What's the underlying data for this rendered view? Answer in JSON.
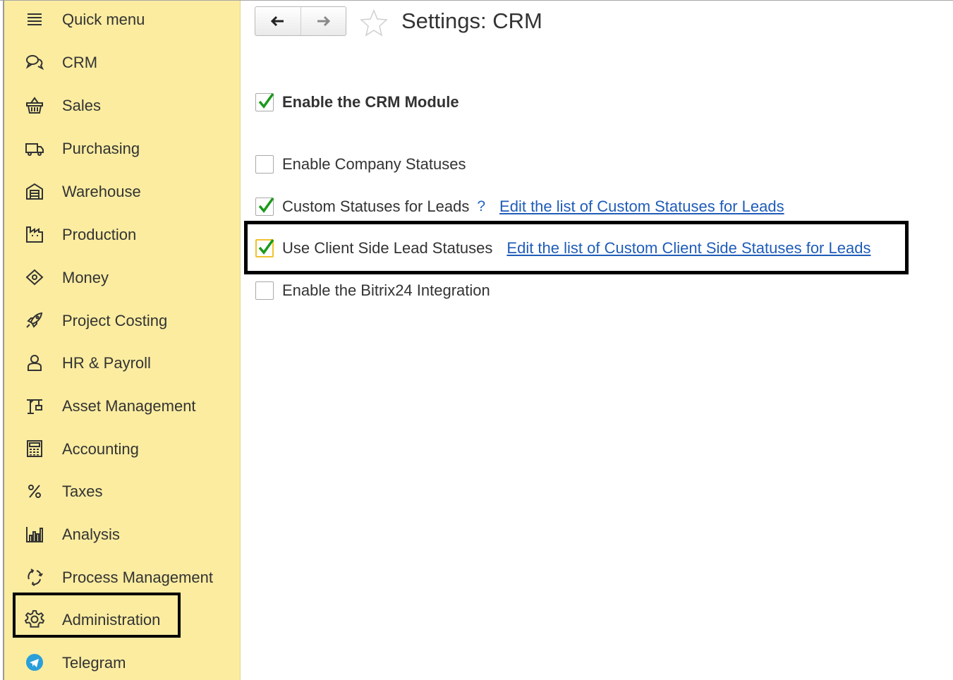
{
  "sidebar": {
    "items": [
      {
        "label": "Quick menu",
        "icon": "hamburger-menu-icon"
      },
      {
        "label": "CRM",
        "icon": "chat-bubbles-icon"
      },
      {
        "label": "Sales",
        "icon": "shopping-basket-icon"
      },
      {
        "label": "Purchasing",
        "icon": "truck-icon"
      },
      {
        "label": "Warehouse",
        "icon": "warehouse-icon"
      },
      {
        "label": "Production",
        "icon": "factory-icon"
      },
      {
        "label": "Money",
        "icon": "money-tag-icon"
      },
      {
        "label": "Project Costing",
        "icon": "rocket-icon"
      },
      {
        "label": "HR & Payroll",
        "icon": "person-icon"
      },
      {
        "label": "Asset Management",
        "icon": "crane-icon"
      },
      {
        "label": "Accounting",
        "icon": "calculator-icon"
      },
      {
        "label": "Taxes",
        "icon": "percent-icon"
      },
      {
        "label": "Analysis",
        "icon": "bar-chart-icon"
      },
      {
        "label": "Process Management",
        "icon": "cycle-arrows-icon"
      },
      {
        "label": "Administration",
        "icon": "gear-icon"
      },
      {
        "label": "Telegram",
        "icon": "telegram-icon"
      }
    ],
    "highlighted": "Administration",
    "background": "#fbeca0"
  },
  "header": {
    "title": "Settings: CRM",
    "back_icon": "arrow-left-icon",
    "forward_icon": "arrow-right-icon",
    "favorite_icon": "star-outline-icon"
  },
  "settings": {
    "enable_crm": {
      "label": "Enable the CRM Module",
      "checked": true
    },
    "company_statuses": {
      "label": "Enable Company Statuses",
      "checked": false
    },
    "custom_statuses": {
      "label": "Custom Statuses for Leads",
      "checked": true,
      "help": "?",
      "link": "Edit the list of Custom Statuses for Leads"
    },
    "client_side_statuses": {
      "label": "Use Client Side Lead Statuses",
      "checked": true,
      "link": "Edit the list of Custom Client Side Statuses for Leads",
      "highlighted": true
    },
    "bitrix24": {
      "label": "Enable the Bitrix24 Integration",
      "checked": false
    }
  },
  "colors": {
    "link": "#1f5cb8",
    "checkmark": "#1a9a1a",
    "focus_border": "#f2c230",
    "highlight_box": "#000000"
  }
}
